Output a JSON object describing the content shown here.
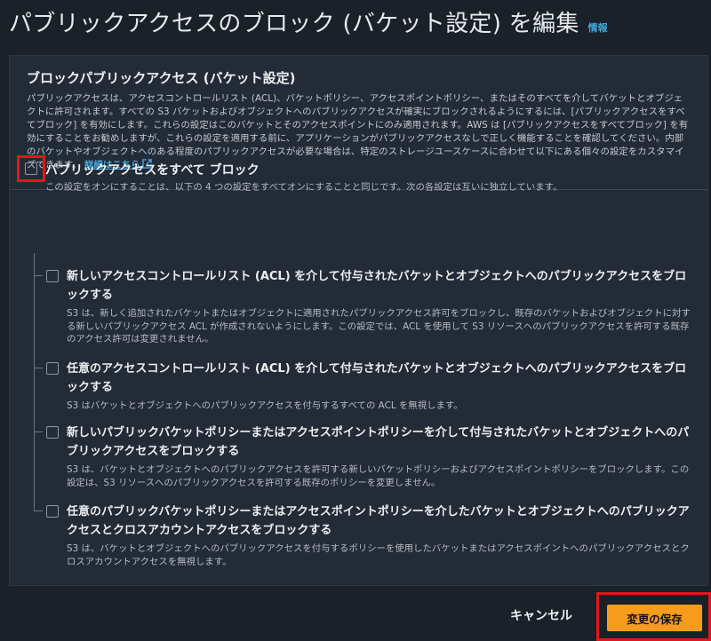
{
  "header": {
    "title": "パブリックアクセスのブロック (バケット設定) を編集",
    "info_link": "情報"
  },
  "panel": {
    "title": "ブロックパブリックアクセス (バケット設定)",
    "description": "パブリックアクセスは、アクセスコントロールリスト (ACL)、バケットポリシー、アクセスポイントポリシー、またはそのすべてを介してバケットとオブジェクトに許可されます。すべての S3 バケットおよびオブジェクトへのパブリックアクセスが確実にブロックされるようにするには、[パブリックアクセスをすべてブロック] を有効にします。これらの設定はこのバケットとそのアクセスポイントにのみ適用されます。AWS は [パブリックアクセスをすべてブロック] を有効にすることをお勧めしますが、これらの設定を適用する前に、アプリケーションがパブリックアクセスなしで正しく機能することを確認してください。内部のバケットやオブジェクトへのある程度のパブリックアクセスが必要な場合は、特定のストレージユースケースに合わせて以下にある個々の設定をカスタマイズできます。",
    "learn_more": "詳細はこちら",
    "learn_more_icon": "external-link-icon"
  },
  "block_all": {
    "label": "パブリックアクセスをすべて ブロック",
    "description": "この設定をオンにすることは、以下の 4 つの設定をすべてオンにすることと同じです。次の各設定は互いに独立しています。",
    "checked": false
  },
  "options": [
    {
      "label": "新しいアクセスコントロールリスト (ACL) を介して付与されたバケットとオブジェクトへのパブリックアクセスをブロックする",
      "description": "S3 は、新しく追加されたバケットまたはオブジェクトに適用されたパブリックアクセス許可をブロックし、既存のバケットおよびオブジェクトに対する新しいパブリックアクセス ACL が作成されないようにします。この設定では、ACL を使用して S3 リソースへのパブリックアクセスを許可する既存のアクセス許可は変更されません。",
      "checked": false
    },
    {
      "label": "任意のアクセスコントロールリスト (ACL) を介して付与されたバケットとオブジェクトへのパブリックアクセスをブロックする",
      "description": "S3 はバケットとオブジェクトへのパブリックアクセスを付与するすべての ACL を無視します。",
      "checked": false
    },
    {
      "label": "新しいパブリックバケットポリシーまたはアクセスポイントポリシーを介して付与されたバケットとオブジェクトへのパブリックアクセスをブロックする",
      "description": "S3 は、バケットとオブジェクトへのパブリックアクセスを許可する新しいバケットポリシーおよびアクセスポイントポリシーをブロックします。この設定は、S3 リソースへのパブリックアクセスを許可する既存のポリシーを変更しません。",
      "checked": false
    },
    {
      "label": "任意のパブリックバケットポリシーまたはアクセスポイントポリシーを介したバケットとオブジェクトへのパブリックアクセスとクロスアカウントアクセスをブロックする",
      "description": "S3 は、バケットとオブジェクトへのパブリックアクセスを付与するポリシーを使用したバケットまたはアクセスポイントへのパブリックアクセスとクロスアカウントアクセスを無視します。",
      "checked": false
    }
  ],
  "footer": {
    "cancel": "キャンセル",
    "save": "変更の保存"
  },
  "colors": {
    "background": "#1b2129",
    "panel": "#232b37",
    "primary_button": "#f89b1d",
    "link": "#45a6de",
    "highlight_outline": "#e3161b"
  }
}
